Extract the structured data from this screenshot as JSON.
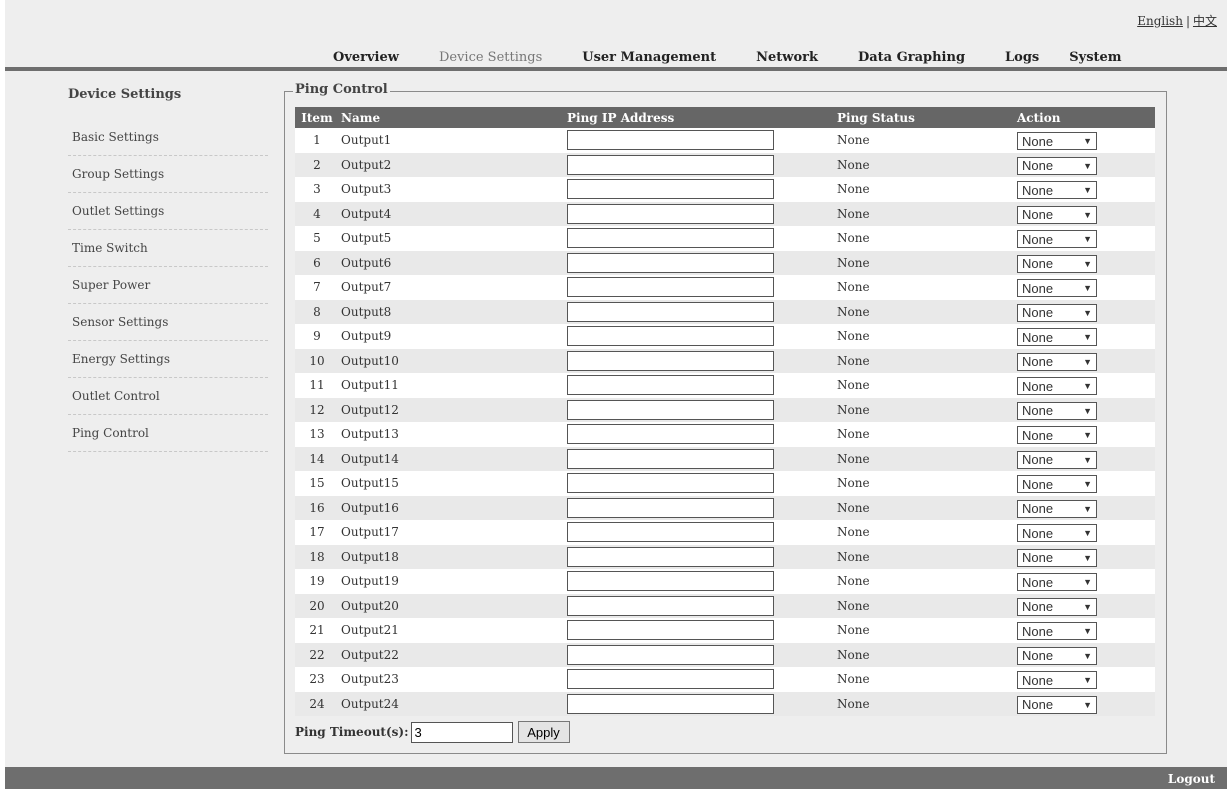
{
  "lang": {
    "english": "English",
    "separator": "|",
    "chinese": "中文"
  },
  "nav": [
    {
      "label": "Overview",
      "active": false
    },
    {
      "label": "Device Settings",
      "active": true
    },
    {
      "label": "User Management",
      "active": false
    },
    {
      "label": "Network",
      "active": false
    },
    {
      "label": "Data Graphing",
      "active": false
    },
    {
      "label": "Logs",
      "active": false
    },
    {
      "label": "System",
      "active": false
    }
  ],
  "sidebar": {
    "title": "Device Settings",
    "items": [
      "Basic Settings",
      "Group Settings",
      "Outlet Settings",
      "Time Switch",
      "Super Power",
      "Sensor Settings",
      "Energy Settings",
      "Outlet Control",
      "Ping Control"
    ]
  },
  "section": {
    "title": "Ping Control"
  },
  "table": {
    "headers": {
      "item": "Item",
      "name": "Name",
      "ip": "Ping IP Address",
      "status": "Ping Status",
      "action": "Action"
    },
    "rows": [
      {
        "item": "1",
        "name": "Output1",
        "ip": "",
        "status": "None",
        "action": "None"
      },
      {
        "item": "2",
        "name": "Output2",
        "ip": "",
        "status": "None",
        "action": "None"
      },
      {
        "item": "3",
        "name": "Output3",
        "ip": "",
        "status": "None",
        "action": "None"
      },
      {
        "item": "4",
        "name": "Output4",
        "ip": "",
        "status": "None",
        "action": "None"
      },
      {
        "item": "5",
        "name": "Output5",
        "ip": "",
        "status": "None",
        "action": "None"
      },
      {
        "item": "6",
        "name": "Output6",
        "ip": "",
        "status": "None",
        "action": "None"
      },
      {
        "item": "7",
        "name": "Output7",
        "ip": "",
        "status": "None",
        "action": "None"
      },
      {
        "item": "8",
        "name": "Output8",
        "ip": "",
        "status": "None",
        "action": "None"
      },
      {
        "item": "9",
        "name": "Output9",
        "ip": "",
        "status": "None",
        "action": "None"
      },
      {
        "item": "10",
        "name": "Output10",
        "ip": "",
        "status": "None",
        "action": "None"
      },
      {
        "item": "11",
        "name": "Output11",
        "ip": "",
        "status": "None",
        "action": "None"
      },
      {
        "item": "12",
        "name": "Output12",
        "ip": "",
        "status": "None",
        "action": "None"
      },
      {
        "item": "13",
        "name": "Output13",
        "ip": "",
        "status": "None",
        "action": "None"
      },
      {
        "item": "14",
        "name": "Output14",
        "ip": "",
        "status": "None",
        "action": "None"
      },
      {
        "item": "15",
        "name": "Output15",
        "ip": "",
        "status": "None",
        "action": "None"
      },
      {
        "item": "16",
        "name": "Output16",
        "ip": "",
        "status": "None",
        "action": "None"
      },
      {
        "item": "17",
        "name": "Output17",
        "ip": "",
        "status": "None",
        "action": "None"
      },
      {
        "item": "18",
        "name": "Output18",
        "ip": "",
        "status": "None",
        "action": "None"
      },
      {
        "item": "19",
        "name": "Output19",
        "ip": "",
        "status": "None",
        "action": "None"
      },
      {
        "item": "20",
        "name": "Output20",
        "ip": "",
        "status": "None",
        "action": "None"
      },
      {
        "item": "21",
        "name": "Output21",
        "ip": "",
        "status": "None",
        "action": "None"
      },
      {
        "item": "22",
        "name": "Output22",
        "ip": "",
        "status": "None",
        "action": "None"
      },
      {
        "item": "23",
        "name": "Output23",
        "ip": "",
        "status": "None",
        "action": "None"
      },
      {
        "item": "24",
        "name": "Output24",
        "ip": "",
        "status": "None",
        "action": "None"
      }
    ]
  },
  "timeout": {
    "label": "Ping Timeout(s):",
    "value": "3",
    "apply_label": "Apply"
  },
  "footer": {
    "logout_label": "Logout"
  },
  "colors": {
    "bar": "#6e6e6e",
    "header_bg": "#666666",
    "page_bg": "#eeeeee"
  }
}
